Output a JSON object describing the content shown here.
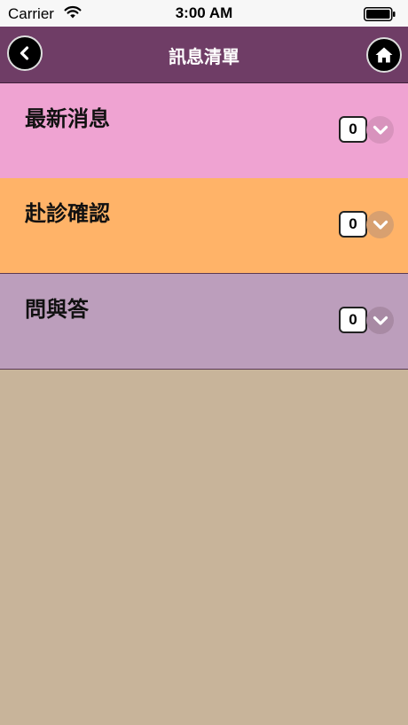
{
  "status_bar": {
    "carrier": "Carrier",
    "time": "3:00 AM"
  },
  "nav": {
    "title": "訊息清單",
    "back_icon": "back-chevron-icon",
    "home_icon": "home-icon"
  },
  "categories": [
    {
      "label": "最新消息",
      "count": "0",
      "color": "#efa3d2"
    },
    {
      "label": "赴診確認",
      "count": "0",
      "color": "#ffb368"
    },
    {
      "label": "問與答",
      "count": "0",
      "color": "#bc9ebc"
    }
  ],
  "colors": {
    "nav_background": "#6f3d66",
    "page_background": "#c8b49a"
  }
}
